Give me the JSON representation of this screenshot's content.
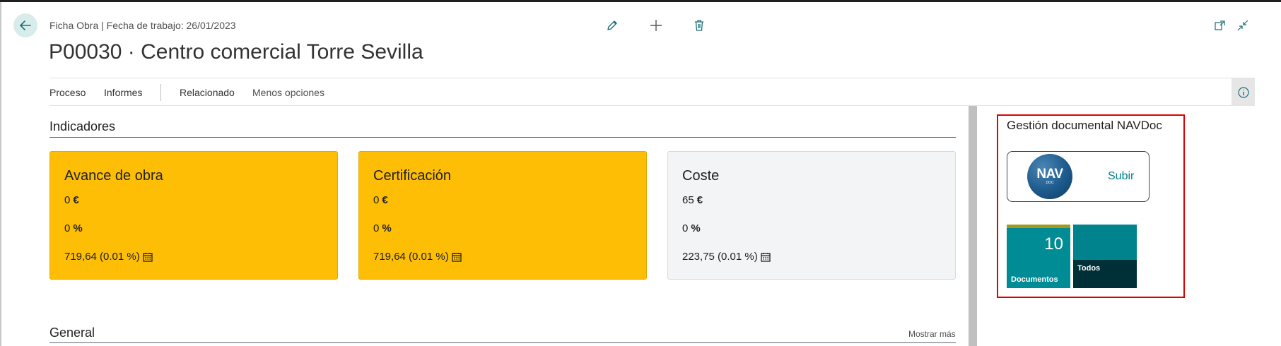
{
  "header": {
    "breadcrumb": "Ficha Obra | Fecha de trabajo: 26/01/2023",
    "title": "P00030 · Centro comercial Torre Sevilla"
  },
  "icons": {
    "back": "back-arrow-icon",
    "edit": "pencil-icon",
    "new": "plus-icon",
    "delete": "trash-icon",
    "open_new_window": "open-in-new-window-icon",
    "collapse": "collapse-icon",
    "info": "info-icon",
    "calendar": "calendar-icon"
  },
  "actions": {
    "proceso": "Proceso",
    "informes": "Informes",
    "relacionado": "Relacionado",
    "menos": "Menos opciones"
  },
  "indicadores": {
    "title": "Indicadores",
    "tiles": [
      {
        "title": "Avance de obra",
        "amount": "0",
        "amount_symbol": "€",
        "percent": "0",
        "percent_symbol": "%",
        "date_value": "719,64 (0.01 %)",
        "style": "yellow"
      },
      {
        "title": "Certificación",
        "amount": "0",
        "amount_symbol": "€",
        "percent": "0",
        "percent_symbol": "%",
        "date_value": "719,64 (0.01 %)",
        "style": "yellow"
      },
      {
        "title": "Coste",
        "amount": "65",
        "amount_symbol": "€",
        "percent": "0",
        "percent_symbol": "%",
        "date_value": "223,75 (0.01 %)",
        "style": "grey"
      }
    ]
  },
  "general": {
    "title": "General",
    "show_more": "Mostrar más"
  },
  "factbox": {
    "title": "Gestión documental NAVDoc",
    "logo_main": "NAV",
    "logo_sub": "DOC",
    "upload_label": "Subir",
    "cues": [
      {
        "label": "Documentos",
        "value": "10"
      },
      {
        "label": "Todos",
        "value": ""
      }
    ]
  },
  "colors": {
    "accent": "#00818a",
    "tile_yellow": "#fdbe05",
    "tile_grey": "#f3f4f6",
    "highlight_border": "#e00000"
  }
}
